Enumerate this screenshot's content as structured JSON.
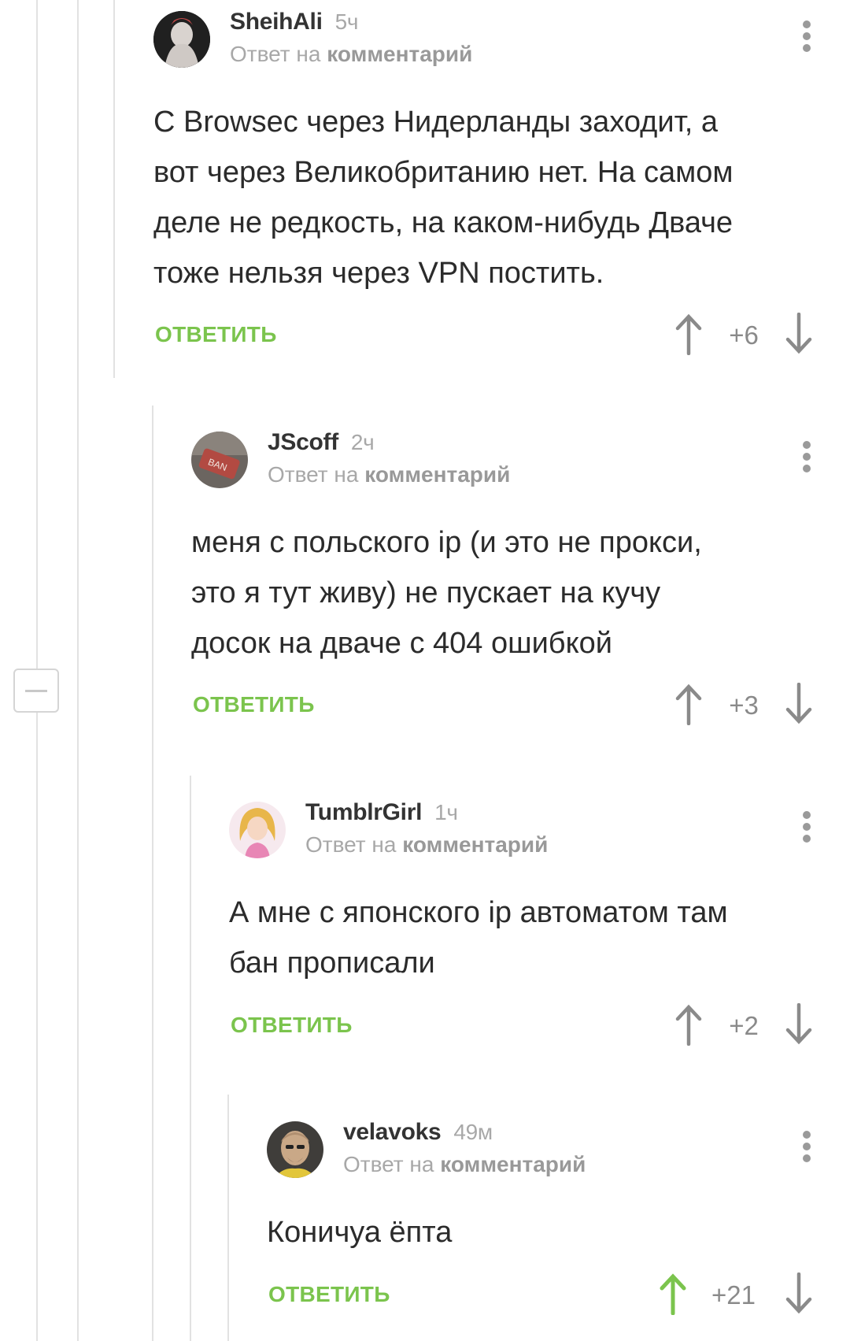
{
  "reply_to_prefix": "Ответ на",
  "reply_to_link": "комментарий",
  "reply_button": "ОТВЕТИТЬ",
  "colors": {
    "accent_green": "#7bc44d",
    "muted": "#a8a8a8",
    "text": "#2b2b2b"
  },
  "comments": [
    {
      "username": "SheihAli",
      "time": "5ч",
      "lines": [
        "С Browsec через Нидерланды заходит, а",
        "вот через Великобританию нет. На самом",
        "деле не редкость, на каком-нибудь Дваче",
        "тоже нельзя через VPN постить."
      ],
      "score": "+6",
      "upvoted": false,
      "avatar_icon": "avatar-sheihali"
    },
    {
      "username": "JScoff",
      "time": "2ч",
      "lines": [
        "меня с польского ip (и это не прокси,",
        "это я тут живу) не пускает на кучу",
        "досок на дваче с 404 ошибкой"
      ],
      "score": "+3",
      "upvoted": false,
      "avatar_icon": "avatar-jscoff"
    },
    {
      "username": "TumblrGirl",
      "time": "1ч",
      "lines": [
        "А мне с японского ip автоматом там",
        "бан прописали"
      ],
      "score": "+2",
      "upvoted": false,
      "avatar_icon": "avatar-tumblrgirl"
    },
    {
      "username": "velavoks",
      "time": "49м",
      "lines": [
        "Коничуа ёпта"
      ],
      "score": "+21",
      "upvoted": true,
      "avatar_icon": "avatar-velavoks"
    }
  ]
}
